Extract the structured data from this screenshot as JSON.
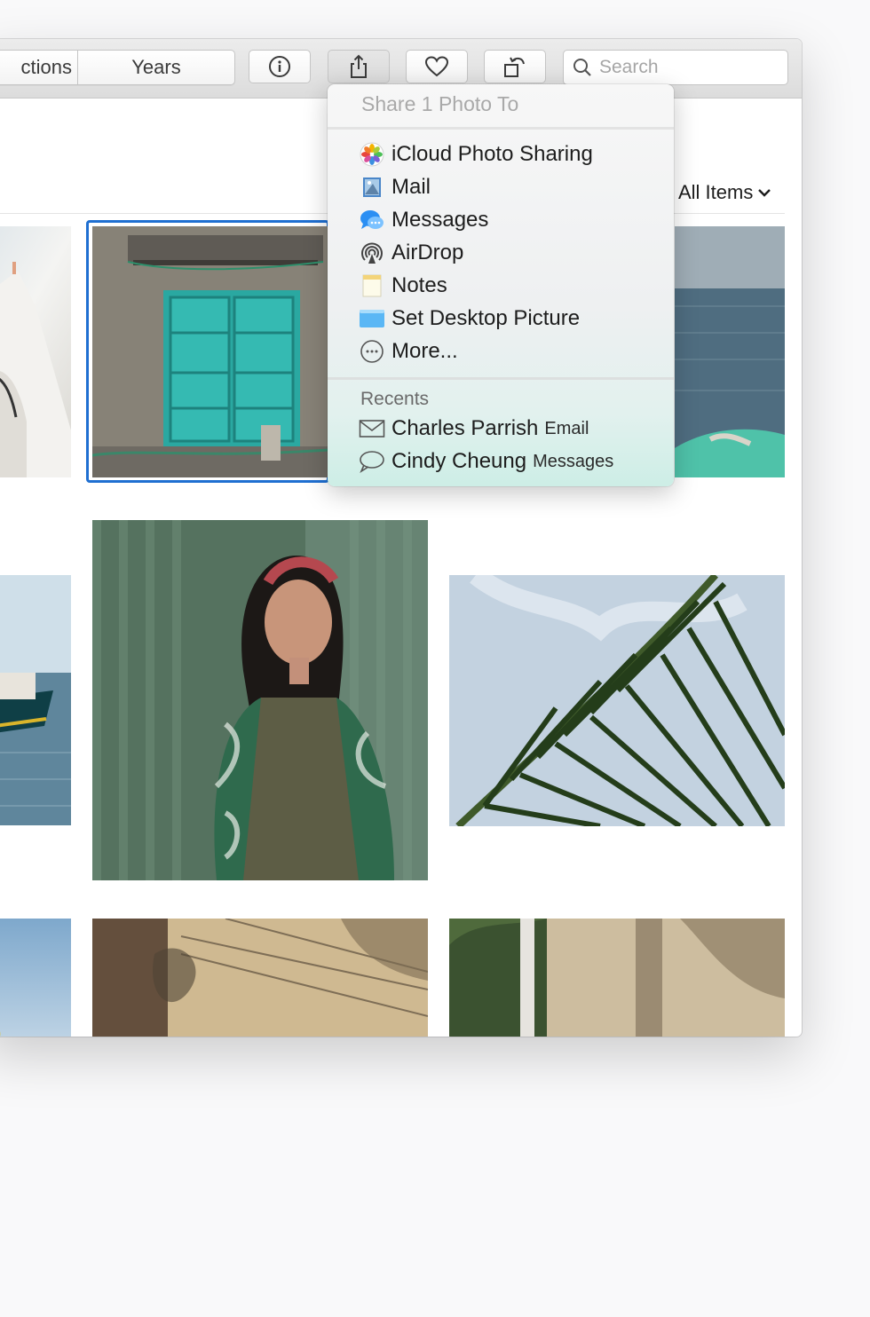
{
  "toolbar": {
    "segments": [
      "ctions",
      "Years"
    ],
    "search_placeholder": "Search",
    "info_icon": "info-circle-icon",
    "share_icon": "share-icon",
    "favorite_icon": "heart-icon",
    "rotate_icon": "rotate-icon"
  },
  "filter": {
    "label": "All Items"
  },
  "share_menu": {
    "header": "Share 1 Photo To",
    "items": [
      {
        "label": "iCloud Photo Sharing",
        "icon": "icloud-photo-sharing-icon"
      },
      {
        "label": "Mail",
        "icon": "mail-icon"
      },
      {
        "label": "Messages",
        "icon": "messages-icon"
      },
      {
        "label": "AirDrop",
        "icon": "airdrop-icon"
      },
      {
        "label": "Notes",
        "icon": "notes-icon"
      },
      {
        "label": "Set Desktop Picture",
        "icon": "desktop-picture-icon"
      },
      {
        "label": "More...",
        "icon": "more-icon"
      }
    ],
    "recents_label": "Recents",
    "recents": [
      {
        "name": "Charles Parrish",
        "via": "Email",
        "icon": "envelope-icon"
      },
      {
        "name": "Cindy Cheung",
        "via": "Messages",
        "icon": "speech-bubble-icon"
      }
    ]
  },
  "colors": {
    "selection": "#1f6fd1",
    "window_bg": "#ffffff",
    "toolbar_bg": "#e4e4e4",
    "menu_tint": "#cdeee6"
  }
}
